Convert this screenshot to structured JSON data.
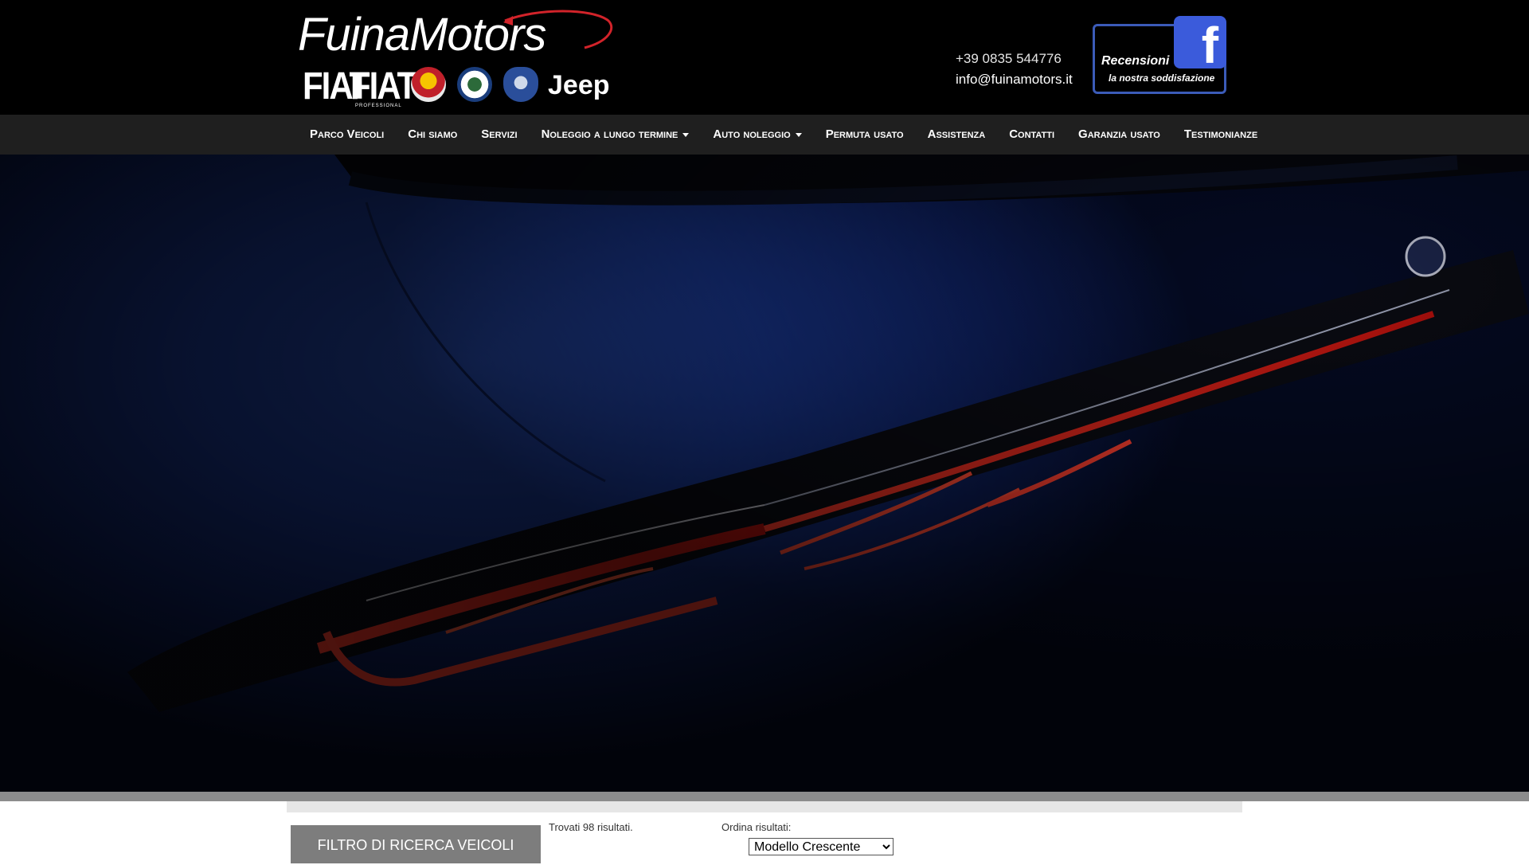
{
  "header": {
    "logo_text": "FuinaMotors",
    "brands": {
      "fiat": "FIAT",
      "fiat_pro": "FIAT",
      "fiat_pro_sub": "PROFESSIONAL",
      "jeep": "Jeep"
    },
    "phone": "+39 0835 544776",
    "email": "info@fuinamotors.it",
    "reviews": {
      "title": "Recensioni",
      "subtitle": "la nostra soddisfazione",
      "fb_letter": "f"
    }
  },
  "nav": {
    "items": [
      {
        "label": "Parco Veicoli",
        "dropdown": false
      },
      {
        "label": "Chi siamo",
        "dropdown": false
      },
      {
        "label": "Servizi",
        "dropdown": false
      },
      {
        "label": "Noleggio a lungo termine",
        "dropdown": true
      },
      {
        "label": "Auto noleggio",
        "dropdown": true
      },
      {
        "label": "Permuta usato",
        "dropdown": false
      },
      {
        "label": "Assistenza",
        "dropdown": false
      },
      {
        "label": "Contatti",
        "dropdown": false
      },
      {
        "label": "Garanzia usato",
        "dropdown": false
      },
      {
        "label": "Testimonianze",
        "dropdown": false
      }
    ]
  },
  "search": {
    "filter_button": "FILTRO DI RICERCA VEICOLI",
    "results_prefix": "Trovati ",
    "results_count": "98",
    "results_suffix": " risultati.",
    "sort_label": "Ordina risultati:",
    "sort_value": "Modello Crescente"
  },
  "colors": {
    "header_bg": "#000000",
    "nav_bg": "#1f1f1f",
    "facebook_blue": "#3b5bdb",
    "filter_button_bg": "#7d7d7d"
  }
}
